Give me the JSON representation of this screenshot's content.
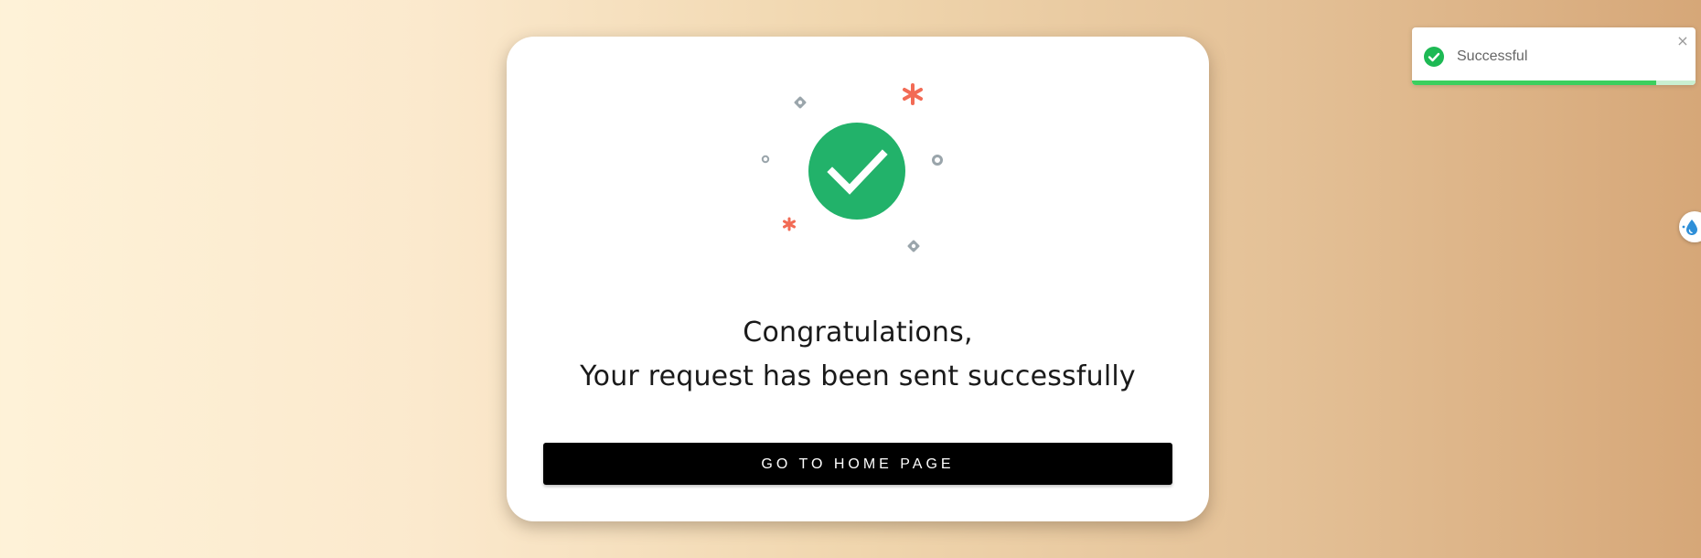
{
  "success_card": {
    "line1": "Congratulations,",
    "line2": "Your request has been sent successfully",
    "button_label": "GO TO HOME PAGE",
    "accent_color": "#22b26a",
    "confetti_star_color": "#f26b55",
    "confetti_shape_color": "#9aa5ab"
  },
  "toast": {
    "message": "Successful",
    "close_glyph": "×",
    "icon": "check-circle-icon",
    "progress": 0.86,
    "accent_color": "#3ccf5e"
  },
  "side_widget": {
    "icon": "water-drop-icon"
  }
}
